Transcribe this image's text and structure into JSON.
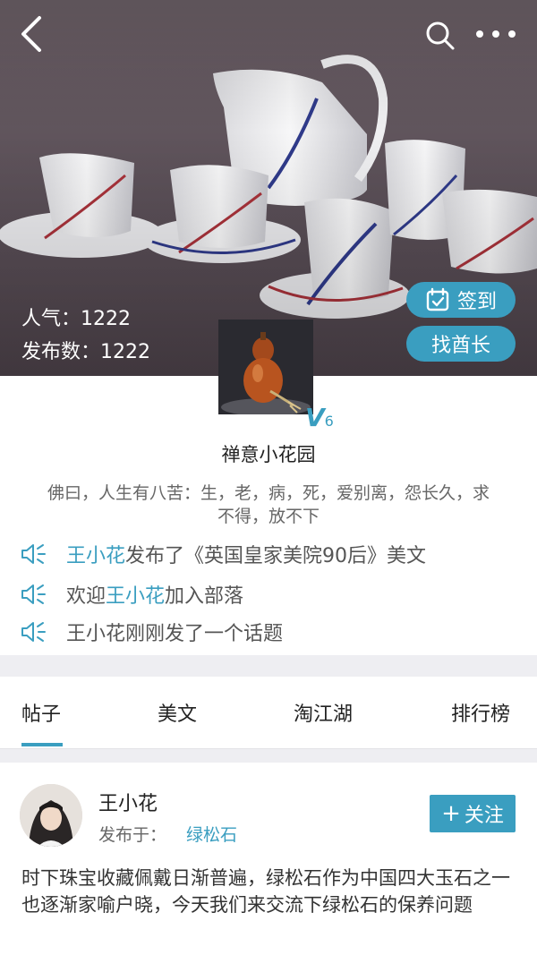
{
  "hero": {
    "stats": {
      "popularity_label": "人气：",
      "popularity_value": "1222",
      "posts_label": "发布数：",
      "posts_value": "1222"
    },
    "checkin_label": "签到",
    "find_chief_label": "找酋长"
  },
  "group": {
    "badge_letter": "V",
    "badge_level": "6",
    "name": "禅意小花园",
    "description": "佛曰，人生有八苦：生，老，病，死，爱别离，怨长久，求不得，放不下"
  },
  "news": [
    {
      "highlight": "王小花",
      "text": "发布了《英国皇家美院90后》美文"
    },
    {
      "prefix": "欢迎",
      "highlight": "王小花",
      "text": "加入部落"
    },
    {
      "text": "王小花刚刚发了一个话题"
    }
  ],
  "tabs": [
    {
      "label": "帖子",
      "active": true
    },
    {
      "label": "美文"
    },
    {
      "label": "淘江湖"
    },
    {
      "label": "排行榜"
    }
  ],
  "post": {
    "user": "王小花",
    "meta_label": "发布于：",
    "location": "绿松石",
    "follow_label": "关注",
    "content": "时下珠宝收藏佩戴日渐普遍，绿松石作为中国四大玉石之一也逐渐家喻户晓，今天我们来交流下绿松石的保养问题"
  },
  "colors": {
    "accent": "#3a9ec0",
    "page_background": "#eeeef2"
  },
  "icons": [
    "back-icon",
    "search-icon",
    "more-icon",
    "calendar-check-icon",
    "speaker-icon",
    "plus-icon"
  ]
}
